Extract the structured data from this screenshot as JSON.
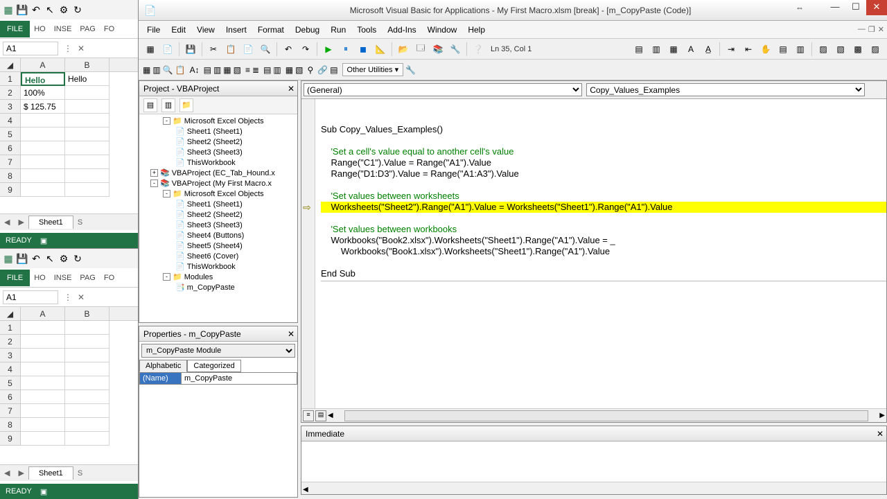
{
  "excel1": {
    "ribbon": {
      "file": "FILE",
      "tabs": [
        "HO",
        "INSE",
        "PAG",
        "FO"
      ]
    },
    "namebox": "A1",
    "cols": [
      "A",
      "B"
    ],
    "rows": [
      {
        "n": "1",
        "a": "Hello",
        "b": "Hello"
      },
      {
        "n": "2",
        "a": "100%",
        "b": ""
      },
      {
        "n": "3",
        "a": "$ 125.75",
        "b": ""
      },
      {
        "n": "4",
        "a": "",
        "b": ""
      },
      {
        "n": "5",
        "a": "",
        "b": ""
      },
      {
        "n": "6",
        "a": "",
        "b": ""
      },
      {
        "n": "7",
        "a": "",
        "b": ""
      },
      {
        "n": "8",
        "a": "",
        "b": ""
      },
      {
        "n": "9",
        "a": "",
        "b": ""
      }
    ],
    "sheet": "Sheet1",
    "sheet_s": "S",
    "status": "READY"
  },
  "excel2": {
    "ribbon": {
      "file": "FILE",
      "tabs": [
        "HO",
        "INSE",
        "PAG",
        "FO"
      ]
    },
    "namebox": "A1",
    "cols": [
      "A",
      "B"
    ],
    "rows": [
      {
        "n": "1",
        "a": "",
        "b": ""
      },
      {
        "n": "2",
        "a": "",
        "b": ""
      },
      {
        "n": "3",
        "a": "",
        "b": ""
      },
      {
        "n": "4",
        "a": "",
        "b": ""
      },
      {
        "n": "5",
        "a": "",
        "b": ""
      },
      {
        "n": "6",
        "a": "",
        "b": ""
      },
      {
        "n": "7",
        "a": "",
        "b": ""
      },
      {
        "n": "8",
        "a": "",
        "b": ""
      },
      {
        "n": "9",
        "a": "",
        "b": ""
      }
    ],
    "sheet": "Sheet1",
    "sheet_s": "S",
    "status": "READY"
  },
  "vbe": {
    "title": "Microsoft Visual Basic for Applications - My First Macro.xlsm [break] - [m_CopyPaste (Code)]",
    "menus": [
      "File",
      "Edit",
      "View",
      "Insert",
      "Format",
      "Debug",
      "Run",
      "Tools",
      "Add-Ins",
      "Window",
      "Help"
    ],
    "pos": "Ln 35, Col 1",
    "util": "Other Utilities ▾",
    "project": {
      "title": "Project - VBAProject",
      "items": [
        {
          "ind": 2,
          "exp": "-",
          "icon": "📁",
          "label": "Microsoft Excel Objects"
        },
        {
          "ind": 3,
          "icon": "📄",
          "label": "Sheet1 (Sheet1)"
        },
        {
          "ind": 3,
          "icon": "📄",
          "label": "Sheet2 (Sheet2)"
        },
        {
          "ind": 3,
          "icon": "📄",
          "label": "Sheet3 (Sheet3)"
        },
        {
          "ind": 3,
          "icon": "📄",
          "label": "ThisWorkbook"
        },
        {
          "ind": 1,
          "exp": "+",
          "icon": "📚",
          "label": "VBAProject (EC_Tab_Hound.x"
        },
        {
          "ind": 1,
          "exp": "-",
          "icon": "📚",
          "label": "VBAProject (My First Macro.x"
        },
        {
          "ind": 2,
          "exp": "-",
          "icon": "📁",
          "label": "Microsoft Excel Objects"
        },
        {
          "ind": 3,
          "icon": "📄",
          "label": "Sheet1 (Sheet1)"
        },
        {
          "ind": 3,
          "icon": "📄",
          "label": "Sheet2 (Sheet2)"
        },
        {
          "ind": 3,
          "icon": "📄",
          "label": "Sheet3 (Sheet3)"
        },
        {
          "ind": 3,
          "icon": "📄",
          "label": "Sheet4 (Buttons)"
        },
        {
          "ind": 3,
          "icon": "📄",
          "label": "Sheet5 (Sheet4)"
        },
        {
          "ind": 3,
          "icon": "📄",
          "label": "Sheet6 (Cover)"
        },
        {
          "ind": 3,
          "icon": "📄",
          "label": "ThisWorkbook"
        },
        {
          "ind": 2,
          "exp": "-",
          "icon": "📁",
          "label": "Modules"
        },
        {
          "ind": 3,
          "icon": "📑",
          "label": "m_CopyPaste"
        }
      ]
    },
    "props": {
      "title": "Properties - m_CopyPaste",
      "obj": "m_CopyPaste Module",
      "tab_alpha": "Alphabetic",
      "tab_cat": "Categorized",
      "name_label": "(Name)",
      "name_value": "m_CopyPaste"
    },
    "code": {
      "dd1": "(General)",
      "dd2": "Copy_Values_Examples",
      "lines": [
        {
          "t": "",
          "c": ""
        },
        {
          "t": "",
          "c": ""
        },
        {
          "t": "Sub Copy_Values_Examples()",
          "c": ""
        },
        {
          "t": "",
          "c": ""
        },
        {
          "t": "    'Set a cell's value equal to another cell's value",
          "c": "comment"
        },
        {
          "t": "    Range(\"C1\").Value = Range(\"A1\").Value",
          "c": ""
        },
        {
          "t": "    Range(\"D1:D3\").Value = Range(\"A1:A3\").Value",
          "c": ""
        },
        {
          "t": "",
          "c": ""
        },
        {
          "t": "    'Set values between worksheets",
          "c": "comment"
        },
        {
          "t": "    Worksheets(\"Sheet2\").Range(\"A1\").Value = Worksheets(\"Sheet1\").Range(\"A1\").Value",
          "c": "hl"
        },
        {
          "t": "",
          "c": ""
        },
        {
          "t": "    'Set values between workbooks",
          "c": "comment"
        },
        {
          "t": "    Workbooks(\"Book2.xlsx\").Worksheets(\"Sheet1\").Range(\"A1\").Value = _",
          "c": ""
        },
        {
          "t": "        Workbooks(\"Book1.xlsx\").Worksheets(\"Sheet1\").Range(\"A1\").Value",
          "c": ""
        },
        {
          "t": "",
          "c": ""
        },
        {
          "t": "End Sub",
          "c": ""
        }
      ],
      "bp_line": 9
    },
    "imm": {
      "title": "Immediate"
    }
  }
}
